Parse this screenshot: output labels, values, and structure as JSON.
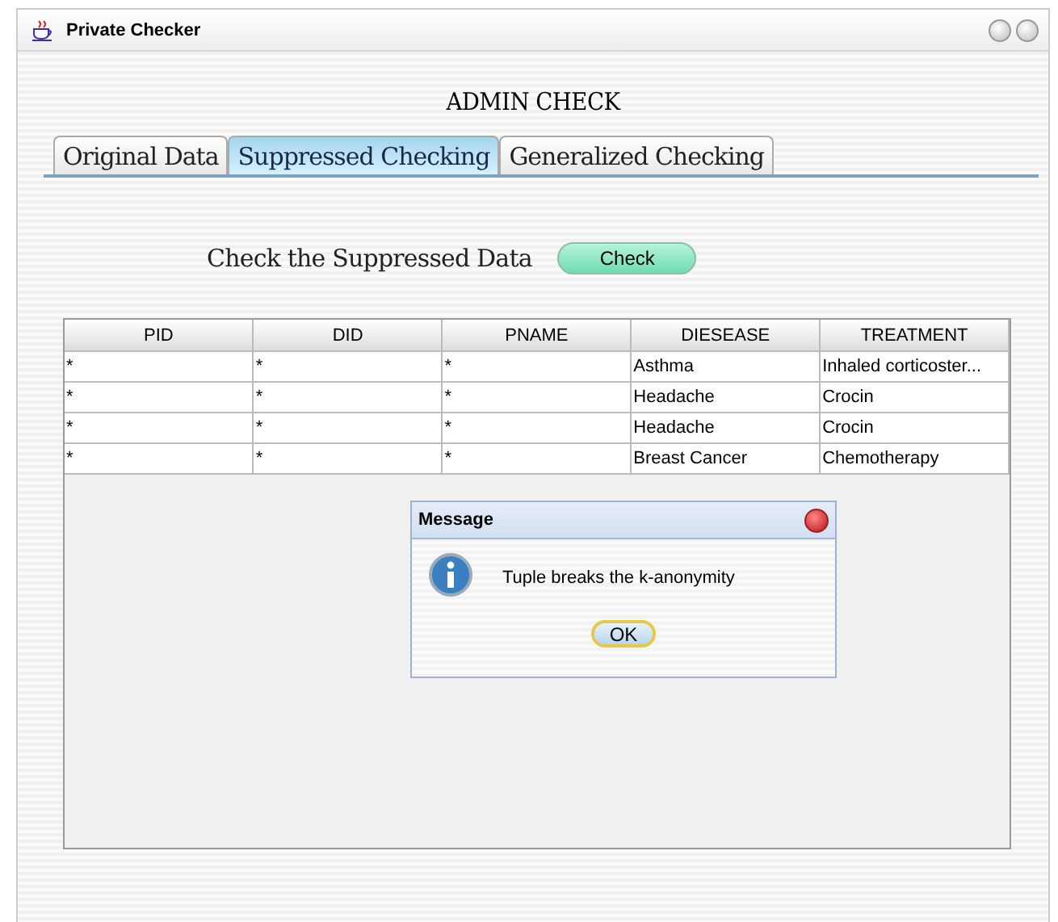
{
  "window": {
    "title": "Private Checker"
  },
  "heading": "ADMIN CHECK",
  "tabs": [
    {
      "label": "Original Data",
      "selected": false
    },
    {
      "label": "Suppressed Checking",
      "selected": true
    },
    {
      "label": "Generalized Checking",
      "selected": false
    }
  ],
  "check": {
    "label": "Check the Suppressed Data",
    "button": "Check"
  },
  "table": {
    "columns": [
      "PID",
      "DID",
      "PNAME",
      "DIESEASE",
      "TREATMENT"
    ],
    "rows": [
      [
        "*",
        "*",
        "*",
        "Asthma",
        "Inhaled corticoster..."
      ],
      [
        "*",
        "*",
        "*",
        "Headache",
        "Crocin"
      ],
      [
        "*",
        "*",
        "*",
        "Headache",
        "Crocin"
      ],
      [
        "*",
        "*",
        "*",
        "Breast Cancer",
        "Chemotherapy"
      ]
    ]
  },
  "dialog": {
    "title": "Message",
    "message": "Tuple breaks the k-anonymity",
    "button": "OK"
  }
}
